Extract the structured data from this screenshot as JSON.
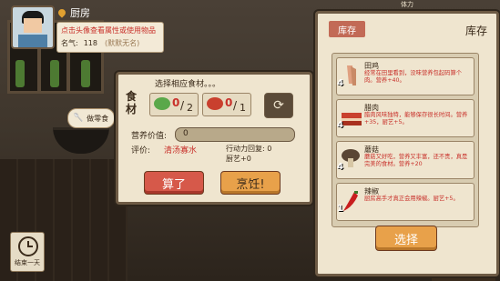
{
  "location": {
    "name": "厨房"
  },
  "player": {
    "hint": "点击头像查看属性或使用物品",
    "fame_label": "名气:",
    "fame_value": "118",
    "title": "(默默无名)"
  },
  "cook_food_button": "做零食",
  "end_day_button": "结束一天",
  "top_tabs": [
    "体力"
  ],
  "cook_panel": {
    "prompt": "选择相应食材。。。",
    "ingredients_label": "食材",
    "slots": [
      {
        "icon": "vegetable-icon",
        "color": "#5aa84a",
        "have": "0",
        "need": "2"
      },
      {
        "icon": "meat-icon",
        "color": "#c9402e",
        "have": "0",
        "need": "1"
      }
    ],
    "nutrition_label": "营养价值:",
    "nutrition_value": "0",
    "eval_label": "评价:",
    "eval_value": "清汤寡水",
    "ap_regen": "行动力回复: 0",
    "skill": "厨艺+0",
    "cancel_button": "算了",
    "cook_button": "烹饪!"
  },
  "inventory": {
    "tab": "库存",
    "title": "库存",
    "select_button": "选择",
    "items": [
      {
        "name": "田鸡",
        "qty": "4",
        "icon": "frog-leg-icon",
        "color": "#e0a080",
        "desc": "经常在田里看到，没味营养包起码算个肉。营养+40。"
      },
      {
        "name": "腊肉",
        "qty": "4",
        "icon": "bacon-icon",
        "color": "#c9402e",
        "desc": "腊肉风味独特，能够保存很长时间。营养+35，厨艺+5。"
      },
      {
        "name": "蘑菇",
        "qty": "4",
        "icon": "mushroom-icon",
        "color": "#6b5640",
        "desc": "蘑菇又好吃，营养又丰富，还不贵，真是完美的食材。营养+20"
      },
      {
        "name": "辣椒",
        "qty": "1",
        "icon": "chili-icon",
        "color": "#c81e1e",
        "desc": "厨房高手才真正会用辣椒。厨艺+5。"
      }
    ]
  }
}
